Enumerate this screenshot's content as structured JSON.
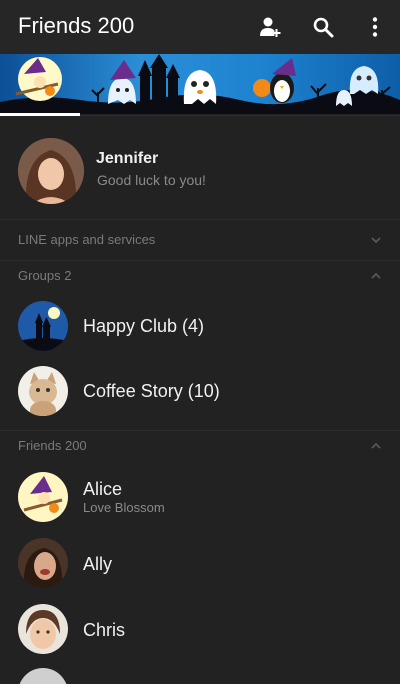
{
  "header": {
    "title": "Friends 200",
    "icons": [
      "add-friend-icon",
      "search-icon",
      "more-icon"
    ]
  },
  "profile": {
    "name": "Jennifer",
    "status": "Good luck to you!"
  },
  "sections": {
    "line_apps": "LINE apps and services",
    "groups": "Groups 2",
    "friends": "Friends 200"
  },
  "groups": [
    {
      "name": "Happy Club (4)"
    },
    {
      "name": "Coffee Story (10)"
    }
  ],
  "friends": [
    {
      "name": "Alice",
      "status": "Love Blossom"
    },
    {
      "name": "Ally",
      "status": ""
    },
    {
      "name": "Chris",
      "status": ""
    }
  ]
}
